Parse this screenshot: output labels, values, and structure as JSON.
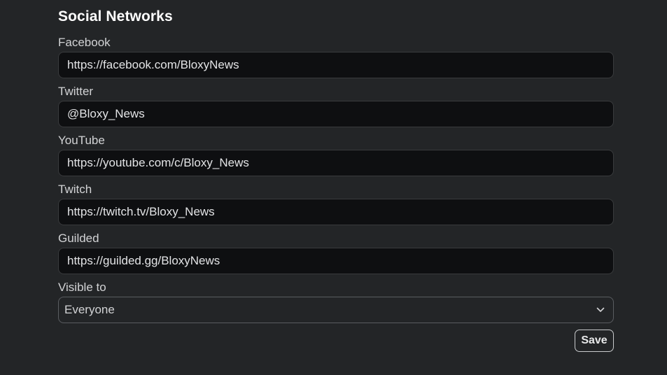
{
  "section": {
    "title": "Social Networks"
  },
  "fields": [
    {
      "label": "Facebook",
      "value": "https://facebook.com/BloxyNews"
    },
    {
      "label": "Twitter",
      "value": "@Bloxy_News"
    },
    {
      "label": "YouTube",
      "value": "https://youtube.com/c/Bloxy_News"
    },
    {
      "label": "Twitch",
      "value": "https://twitch.tv/Bloxy_News"
    },
    {
      "label": "Guilded",
      "value": "https://guilded.gg/BloxyNews"
    }
  ],
  "visibility": {
    "label": "Visible to",
    "selected": "Everyone",
    "icon": "chevron-down-icon"
  },
  "actions": {
    "save_label": "Save"
  },
  "colors": {
    "background": "#232527",
    "input_background": "#0e0f11",
    "text": "#ffffff"
  }
}
